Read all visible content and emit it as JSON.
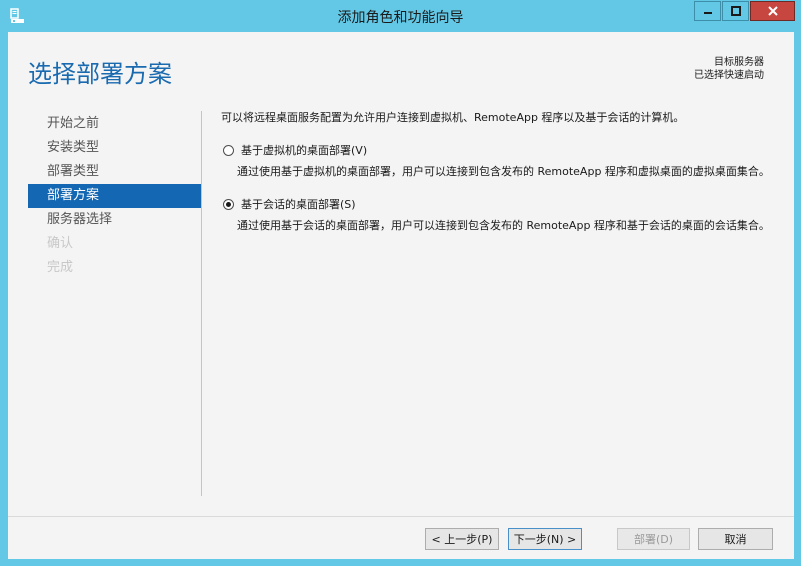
{
  "window": {
    "title": "添加角色和功能向导"
  },
  "header": {
    "page_title": "选择部署方案",
    "target_label": "目标服务器",
    "target_value": "已选择快速启动"
  },
  "nav": {
    "items": [
      {
        "label": "开始之前",
        "state": "normal"
      },
      {
        "label": "安装类型",
        "state": "normal"
      },
      {
        "label": "部署类型",
        "state": "normal"
      },
      {
        "label": "部署方案",
        "state": "active"
      },
      {
        "label": "服务器选择",
        "state": "normal"
      },
      {
        "label": "确认",
        "state": "disabled"
      },
      {
        "label": "完成",
        "state": "disabled"
      }
    ]
  },
  "main": {
    "intro": "可以将远程桌面服务配置为允许用户连接到虚拟机、RemoteApp 程序以及基于会话的计算机。",
    "options": [
      {
        "label": "基于虚拟机的桌面部署(V)",
        "selected": false,
        "description": "通过使用基于虚拟机的桌面部署，用户可以连接到包含发布的 RemoteApp 程序和虚拟桌面的虚拟桌面集合。"
      },
      {
        "label": "基于会话的桌面部署(S)",
        "selected": true,
        "description": "通过使用基于会话的桌面部署，用户可以连接到包含发布的 RemoteApp 程序和基于会话的桌面的会话集合。"
      }
    ]
  },
  "buttons": {
    "prev": "< 上一步(P)",
    "next": "下一步(N) >",
    "deploy": "部署(D)",
    "cancel": "取消"
  },
  "colors": {
    "titlebar": "#62c8e6",
    "accent": "#1467b2",
    "close": "#c7463f"
  }
}
